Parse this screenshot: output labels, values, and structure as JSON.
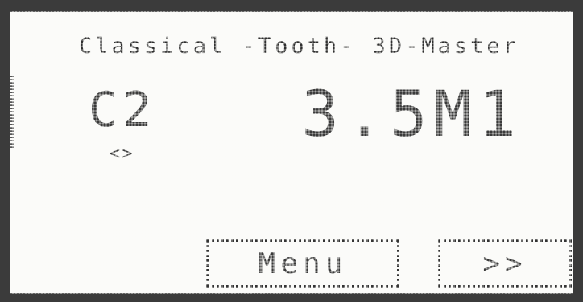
{
  "display": {
    "title": "Classical -Tooth- 3D-Master",
    "classical_shade": "C2",
    "classical_sub": "<>",
    "master_shade": "3.5M1"
  },
  "buttons": {
    "menu_label": "Menu",
    "next_label": ">>"
  },
  "colors": {
    "bezel": "#3b3b3b",
    "screen_bg": "#fbfbf9",
    "lcd_text": "#2c2c2c"
  }
}
